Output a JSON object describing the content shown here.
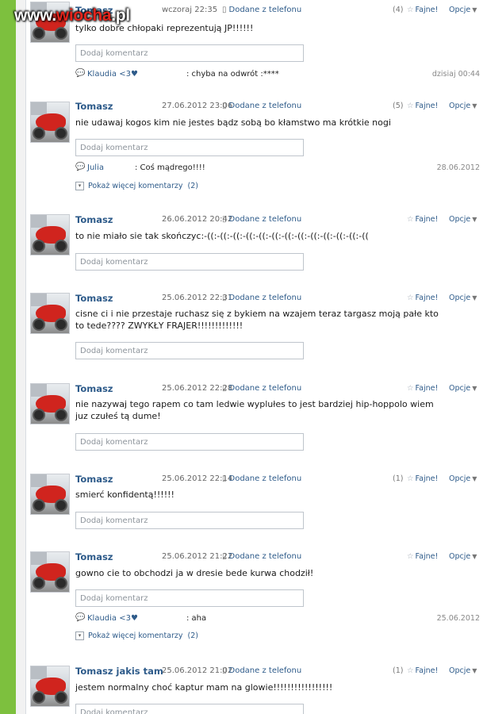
{
  "logo": {
    "pre": "www.",
    "mid": "wiocha",
    "post": ".pl"
  },
  "labels": {
    "from_phone": "Dodane z telefonu",
    "fajne": "Fajne!",
    "opcje": "Opcje",
    "comment_placeholder": "Dodaj komentarz",
    "show_more": "Pokaż więcej komentarzy"
  },
  "posts": [
    {
      "author": "Tomasz",
      "date": "wczoraj 22:35",
      "likes": "(4)",
      "text": "tylko dobre chłopaki reprezentują JP!!!!!!",
      "reply": {
        "name": "Klaudia <3♥",
        "text": ": chyba na odwrót :****",
        "date": "dzisiaj 00:44"
      }
    },
    {
      "author": "Tomasz",
      "date": "27.06.2012 23:06",
      "likes": "(5)",
      "text": "nie udawaj kogos kim nie jestes bądz sobą bo kłamstwo ma krótkie nogi",
      "reply": {
        "name": "Julia",
        "text": ": Coś mądrego!!!!",
        "date": "28.06.2012"
      },
      "more_count": "(2)"
    },
    {
      "author": "Tomasz",
      "date": "26.06.2012 20:42",
      "likes": "",
      "text": "to nie miało sie tak skończyc:-((:-((:-((:-((:-((:-((:-((:-((:-((:-((:-((:-((:-(("
    },
    {
      "author": "Tomasz",
      "date": "25.06.2012 22:31",
      "likes": "",
      "text": "cisne ci i nie przestaje ruchasz się z bykiem na wzajem teraz targasz moją pałe kto to tede???? ZWYKŁY FRAJER!!!!!!!!!!!!!"
    },
    {
      "author": "Tomasz",
      "date": "25.06.2012 22:28",
      "likes": "",
      "text": "nie nazywaj tego rapem co tam ledwie wyplułes to jest bardziej hip-hoppolo wiem juz czułeś tą dume!"
    },
    {
      "author": "Tomasz",
      "date": "25.06.2012 22:14",
      "likes": "(1)",
      "text": "smierć konfidentą!!!!!!"
    },
    {
      "author": "Tomasz",
      "date": "25.06.2012 21:22",
      "likes": "",
      "text": "gowno cie to obchodzi ja w dresie bede kurwa chodził!",
      "reply": {
        "name": "Klaudia <3♥",
        "text": ": aha",
        "date": "25.06.2012"
      },
      "more_count": "(2)"
    },
    {
      "author": "Tomasz jakis tam",
      "date": "25.06.2012 21:02",
      "likes": "(1)",
      "text": "jestem normalny choć kaptur mam na glowie!!!!!!!!!!!!!!!!!"
    }
  ]
}
